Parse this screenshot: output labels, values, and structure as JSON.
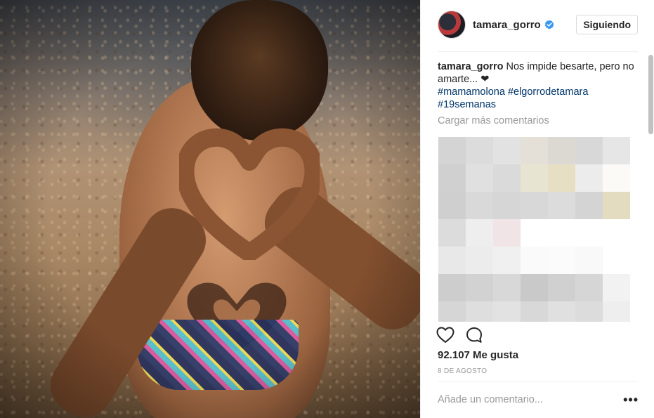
{
  "post": {
    "image_alt_icon": "photo-heart-hands",
    "author": {
      "username": "tamara_gorro",
      "verified_icon": "verified-badge-icon",
      "avatar_icon": "avatar-image"
    },
    "follow_button_label": "Siguiendo",
    "caption": {
      "username": "tamara_gorro",
      "text": "Nos impide besarte, pero no amarte... ❤",
      "hashtags": [
        "#mamamolona",
        "#elgorrodetamara",
        "#19semanas"
      ]
    },
    "load_more_label": "Cargar más comentarios",
    "actions": {
      "like_icon": "heart-outline-icon",
      "comment_icon": "comment-bubble-icon"
    },
    "likes_text": "92.107 Me gusta",
    "date_text": "8 DE AGOSTO",
    "comment_input": {
      "placeholder": "Añade un comentario...",
      "value": ""
    },
    "more_options_label": "•••"
  },
  "colors": {
    "link": "#003569",
    "verified": "#3897f0",
    "muted": "#999999",
    "text": "#262626",
    "border": "#dbdbdb"
  }
}
